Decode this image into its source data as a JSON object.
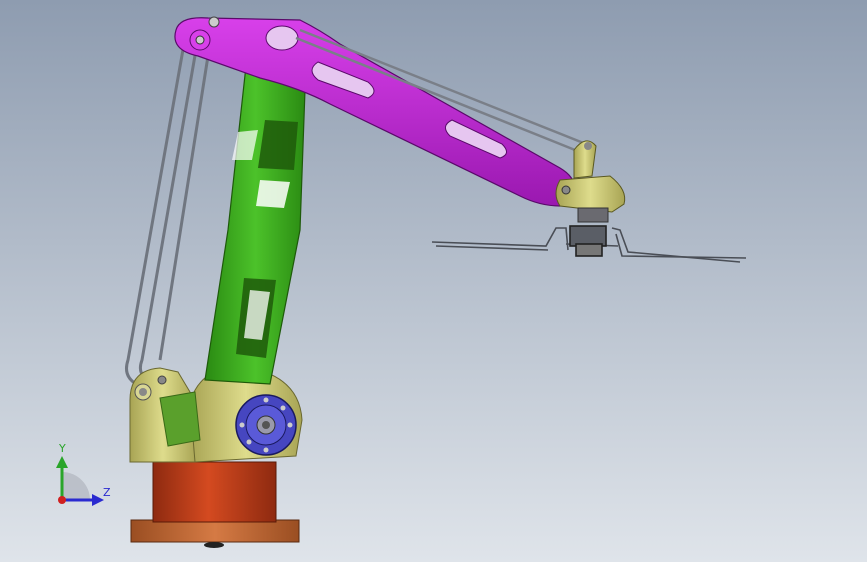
{
  "viewport": {
    "background_top": "#8e9cb0",
    "background_bottom": "#dfe4ea"
  },
  "colors": {
    "base_plate": "#c56a35",
    "base_column": "#c8401a",
    "base_yoke": "#cfcd78",
    "lower_arm": "#3fae20",
    "upper_arm": "#c02ad4",
    "motor_flange": "#4646c0",
    "linkage": "#8a8f98",
    "wrist": "#c8c678"
  },
  "triad": {
    "y_label": "Y",
    "z_label": "Z",
    "y_color": "#2aa52a",
    "z_color": "#2a2ad0",
    "origin_color": "#d02020",
    "y_icon": "y-axis-arrow-icon",
    "z_icon": "z-axis-arrow-icon",
    "origin_icon": "origin-point-icon"
  }
}
